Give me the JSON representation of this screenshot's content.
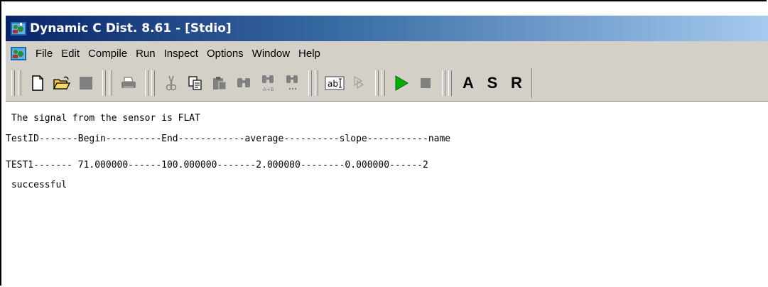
{
  "window": {
    "title": "Dynamic C Dist. 8.61 - [Stdio]",
    "title_icon": "dynamic-c-app-icon"
  },
  "menubar": {
    "icon": "dynamic-c-doc-icon",
    "items": [
      {
        "label": "File"
      },
      {
        "label": "Edit"
      },
      {
        "label": "Compile"
      },
      {
        "label": "Run"
      },
      {
        "label": "Inspect"
      },
      {
        "label": "Options"
      },
      {
        "label": "Window"
      },
      {
        "label": "Help"
      }
    ]
  },
  "toolbar": {
    "buttons": [
      {
        "name": "new-file-icon"
      },
      {
        "name": "open-folder-icon"
      },
      {
        "name": "save-icon"
      },
      {
        "name": "print-icon"
      },
      {
        "name": "cut-icon"
      },
      {
        "name": "copy-icon"
      },
      {
        "name": "paste-icon"
      },
      {
        "name": "find-icon"
      },
      {
        "name": "replace-icon"
      },
      {
        "name": "find-next-icon"
      },
      {
        "name": "text-field-icon"
      },
      {
        "name": "stop-debug-icon"
      },
      {
        "name": "run-icon"
      },
      {
        "name": "stop-icon"
      }
    ],
    "letter_buttons": {
      "a": "A",
      "s": "S",
      "r": "R"
    },
    "colors": {
      "run_green": "#00b000",
      "face": "#d4d0c8"
    }
  },
  "output": {
    "lines": [
      " The signal from the sensor is FLAT",
      "TestID-------Begin----------End------------average----------slope-----------name",
      "TEST1------- 71.000000------100.000000-------2.000000--------0.000000------2",
      " successful"
    ]
  }
}
